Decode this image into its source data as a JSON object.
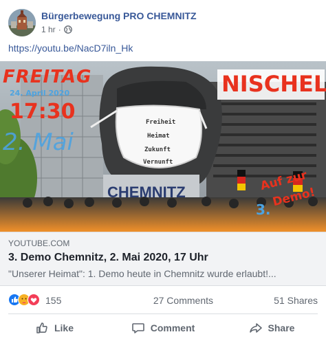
{
  "post": {
    "page_name": "Bürgerbewegung PRO CHEMNITZ",
    "time": "1 hr",
    "separator": "·",
    "privacy_icon": "globe-icon",
    "link_text": "https://youtu.be/NacD7iln_Hk"
  },
  "thumbnail": {
    "freitag": "FREITAG",
    "date": "24. April 2020",
    "time": "17:30",
    "mai": "2. Mai",
    "nischel": "NISCHEL",
    "mask_words": [
      "Freiheit",
      "Heimat",
      "Zukunft",
      "Vernunft"
    ],
    "pedestal": "CHEMNITZ",
    "auf_zur": "Auf zur",
    "demo": "Demo!",
    "three": "3."
  },
  "link_card": {
    "domain": "YOUTUBE.COM",
    "title": "3. Demo Chemnitz, 2. Mai 2020, 17 Uhr",
    "description": "\"Unserer Heimat\": 1. Demo heute in Chemnitz wurde erlaubt!..."
  },
  "stats": {
    "reaction_icons": [
      "like-icon",
      "care-icon",
      "love-icon"
    ],
    "reaction_count": "155",
    "comments": "27 Comments",
    "shares": "51 Shares"
  },
  "actions": {
    "like": "Like",
    "comment": "Comment",
    "share": "Share"
  },
  "colors": {
    "link_blue": "#385898",
    "meta_gray": "#606770",
    "like_blue": "#1877f2",
    "love_red": "#f33e58",
    "care_yellow": "#f7b125",
    "thumb_red": "#e8321e",
    "thumb_blue": "#4da3e0",
    "thumb_orange": "#f0902a"
  }
}
